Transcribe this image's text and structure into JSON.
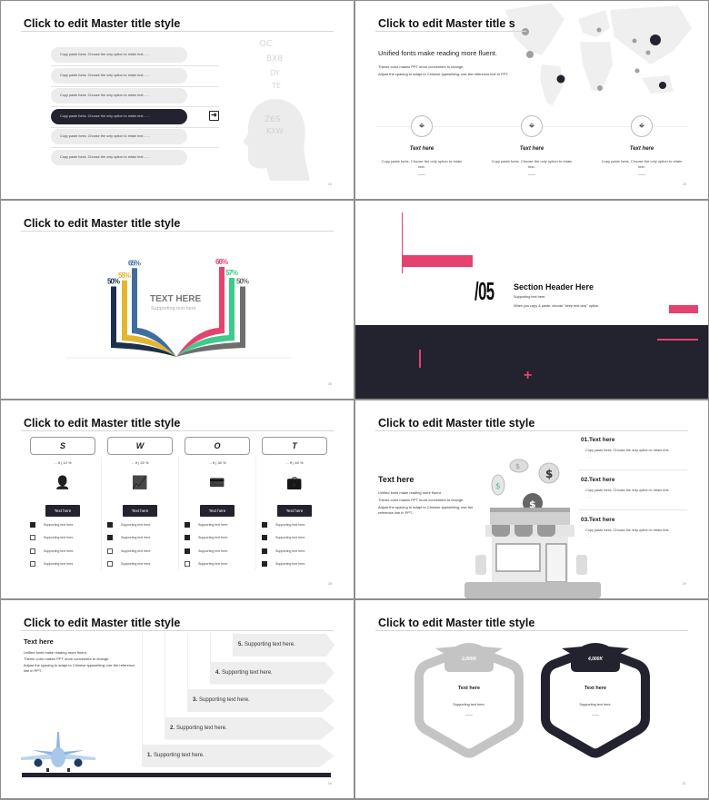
{
  "slides": [
    {
      "title": "Click to edit Master title style",
      "page": "24",
      "items": [
        "Copy paste fonts. Choose the only option to retain text……",
        "Copy paste fonts. Choose the only option to retain text……",
        "Copy paste fonts. Choose the only option to retain text……",
        "Copy paste fonts. Choose the only option to retain text……",
        "Copy paste fonts. Choose the only option to retain text……",
        "Copy paste fonts. Choose the only option to retain text……"
      ],
      "active_index": 3,
      "active_icon": "exit-arrow-icon"
    },
    {
      "title": "Click to edit Master title s",
      "page": "25",
      "subtitle": "Unified fonts make reading more fluent.",
      "body": [
        "Theme color makes PPT more convenient to change.",
        "Adjust the spacing to adapt to Chinese typesetting, use the reference line in PPT."
      ],
      "columns": [
        {
          "heading": "Text here",
          "text": "Copy paste fonts. Choose the only option to retain text.",
          "icon": "location-pin-icon"
        },
        {
          "heading": "Text here",
          "text": "Copy paste fonts. Choose the only option to retain text.",
          "icon": "location-pin-icon"
        },
        {
          "heading": "Text here",
          "text": "Copy paste fonts. Choose the only option to retain text.",
          "icon": "location-pin-icon"
        }
      ]
    },
    {
      "title": "Click to edit Master title style",
      "page": "26",
      "center_title": "TEXT HERE",
      "center_sub": "Supporting text here",
      "left_bars": [
        {
          "label": "50%",
          "value": 50,
          "color": "#1c2f4d"
        },
        {
          "label": "55%",
          "value": 55,
          "color": "#e3b531"
        },
        {
          "label": "65%",
          "value": 65,
          "color": "#3f6e9e"
        }
      ],
      "right_bars": [
        {
          "label": "66%",
          "value": 66,
          "color": "#e6426f"
        },
        {
          "label": "57%",
          "value": 57,
          "color": "#3dcb8a"
        },
        {
          "label": "50%",
          "value": 50,
          "color": "#6e6e6e"
        }
      ]
    },
    {
      "number": "/05",
      "header": "Section Header Here",
      "sub1": "Supporting text here.",
      "sub2": "When you copy & paste, choose \"keep text only\" option.",
      "accent": "#e6426f",
      "dark": "#22232e"
    },
    {
      "title": "Click to edit Master title style",
      "page": "28",
      "columns": [
        {
          "letter": "S",
          "money": "... ¥ | 10 %",
          "icon": "businessman-dollar-icon",
          "glyph": "👤",
          "button": "Text here",
          "checks": [
            true,
            false,
            false,
            false
          ]
        },
        {
          "letter": "W",
          "money": "... ¥ | 20 %",
          "icon": "growth-chart-icon",
          "glyph": "📈",
          "button": "Text here",
          "checks": [
            true,
            true,
            false,
            false
          ]
        },
        {
          "letter": "O",
          "money": "... ¥ | 30 %",
          "icon": "hand-payment-icon",
          "glyph": "💳",
          "button": "Text here",
          "checks": [
            true,
            true,
            true,
            false
          ]
        },
        {
          "letter": "T",
          "money": "... ¥ | 40 %",
          "icon": "briefcase-icon",
          "glyph": "💼",
          "button": "Text here",
          "checks": [
            true,
            true,
            true,
            true
          ]
        }
      ],
      "check_label": "Supporting text here."
    },
    {
      "title": "Click to edit Master title style",
      "page": "29",
      "heading": "Text here",
      "body": [
        "Unified fonts make reading more fluent.",
        "Theme color makes PPT more convenient to change.",
        "Adjust the spacing to adapt to Chinese typesetting, use the reference line in PPT."
      ],
      "items": [
        {
          "title": "01.Text here",
          "text": "Copy paste fonts. Choose the only option to retain text.",
          "more": "……"
        },
        {
          "title": "02.Text here",
          "text": "Copy paste fonts. Choose the only option to retain text.",
          "more": "……"
        },
        {
          "title": "03.Text here",
          "text": "Copy paste fonts. Choose the only option to retain text.",
          "more": "……"
        }
      ]
    },
    {
      "title": "Click to edit Master title style",
      "page": "30",
      "heading": "Text here",
      "body": [
        "Unified fonts make reading more fluent.",
        "Theme color makes PPT more convenient to change.",
        "Adjust the spacing to adapt to Chinese typesetting, use the reference line in PPT."
      ],
      "steps": [
        {
          "num": "1.",
          "text": "Supporting text here."
        },
        {
          "num": "2.",
          "text": "Supporting text here."
        },
        {
          "num": "3.",
          "text": "Supporting text here."
        },
        {
          "num": "4.",
          "text": "Supporting text here."
        },
        {
          "num": "5.",
          "text": "Supporting text here."
        }
      ]
    },
    {
      "title": "Click to edit Master title style",
      "page": "31",
      "cards": [
        {
          "value": "3,000K",
          "heading": "Text here",
          "text": "Supporting text here.",
          "more": "……",
          "color": "#c4c4c4"
        },
        {
          "value": "4,000K",
          "heading": "Text here",
          "text": "Supporting text here.",
          "more": "……",
          "color": "#22232e"
        }
      ]
    }
  ]
}
